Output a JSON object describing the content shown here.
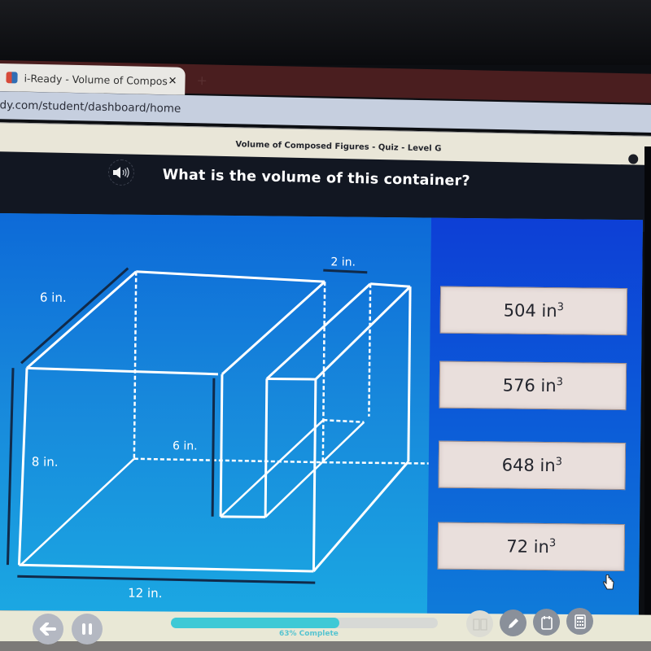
{
  "browser": {
    "tab_title": "i-Ready - Volume of Composed F",
    "tab_close_icon": "close-icon",
    "new_tab_icon": "plus-icon",
    "url": "dy.com/student/dashboard/home"
  },
  "quiz": {
    "header_title": "Volume of Composed Figures - Quiz - Level G",
    "audio_icon": "speaker-icon",
    "question": "What is the volume of this container?"
  },
  "diagram": {
    "labels": {
      "depth": "6 in.",
      "gap_width": "2 in.",
      "inner_height": "6 in.",
      "outer_height": "8 in.",
      "length": "12 in."
    }
  },
  "answers": [
    {
      "value": "504 in",
      "exponent": "3"
    },
    {
      "value": "576 in",
      "exponent": "3"
    },
    {
      "value": "648 in",
      "exponent": "3"
    },
    {
      "value": "72 in",
      "exponent": "3"
    }
  ],
  "footer": {
    "back_icon": "back-arrow-icon",
    "pause_icon": "pause-icon",
    "progress_percent": 63,
    "progress_label": "63% Complete",
    "tools": [
      {
        "name": "glossary-icon",
        "disabled": true
      },
      {
        "name": "pencil-icon",
        "disabled": false
      },
      {
        "name": "notepad-icon",
        "disabled": false
      },
      {
        "name": "calculator-icon",
        "disabled": false
      }
    ]
  },
  "colors": {
    "diagram_bg": "#1787db",
    "answers_bg": "#0c5bd8",
    "answer_card": "#e9dfdc",
    "progress_fill": "#3ec9d6",
    "tab_strip": "#4a1e1f"
  }
}
